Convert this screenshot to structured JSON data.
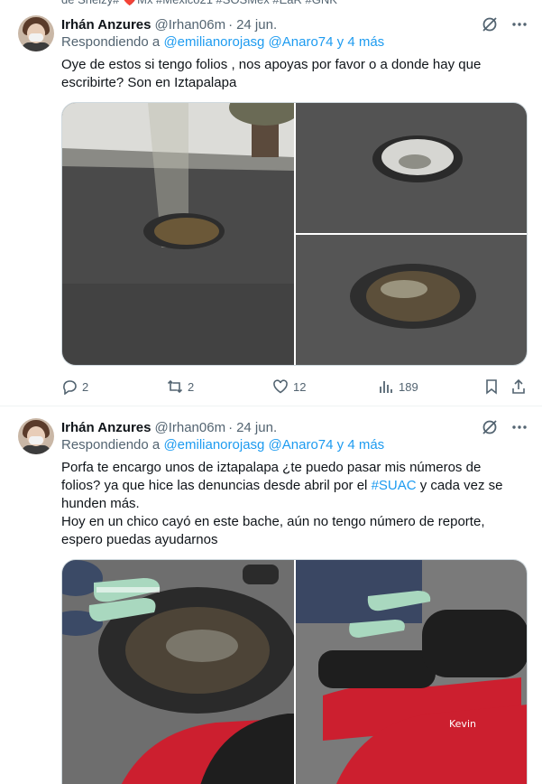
{
  "top_strip_text": "de Shelzy# ❤️Mx #Mexico21 #SOSMex #EaR #GNK",
  "colors": {
    "link": "#1d9bf0",
    "muted": "#536471",
    "text": "#0f1419"
  },
  "tweets": [
    {
      "author": {
        "name": "Irhán Anzures",
        "handle": "@Irhan06m",
        "separator": "·",
        "date": "24 jun."
      },
      "reply": {
        "prefix": "Respondiendo a",
        "mentions": "@emilianorojasg @Anaro74 y 4 más"
      },
      "text_parts": [
        "Oye de estos si tengo folios , nos apoyas por favor o a donde hay que escribirte? Son en Iztapalapa"
      ],
      "stats": {
        "replies": "2",
        "retweets": "2",
        "likes": "12",
        "views": "189"
      },
      "icons": [
        "grok-icon",
        "more-icon",
        "reply-icon",
        "retweet-icon",
        "like-icon",
        "views-icon",
        "bookmark-icon",
        "share-icon"
      ]
    },
    {
      "author": {
        "name": "Irhán Anzures",
        "handle": "@Irhan06m",
        "separator": "·",
        "date": "24 jun."
      },
      "reply": {
        "prefix": "Respondiendo a",
        "mentions": "@emilianorojasg @Anaro74 y 4 más"
      },
      "text_parts": [
        "Porfa te encargo unos de iztapalapa ¿te puedo pasar mis números de folios? ya que hice las denuncias desde abril por el ",
        "#SUAC",
        " y cada vez se hunden más.",
        "Hoy en un chico cayó en este bache, aún no tengo número de reporte, espero puedas ayudarnos"
      ],
      "photo_text": "Kevin"
    }
  ]
}
